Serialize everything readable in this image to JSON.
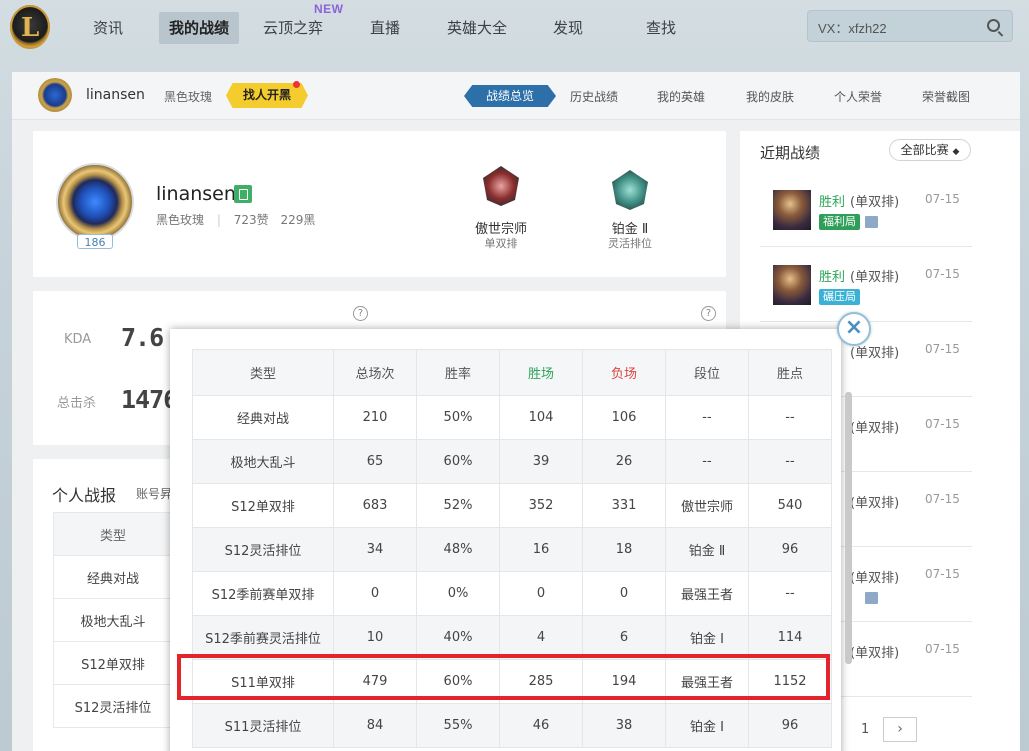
{
  "topnav": {
    "logo_text": "L",
    "items": [
      "资讯",
      "我的战绩",
      "云顶之弈",
      "直播",
      "英雄大全",
      "发现",
      "查找"
    ],
    "active": "我的战绩",
    "new_badge": "NEW",
    "search_value": "VX：xfzh22"
  },
  "subnav": {
    "username": "linansen",
    "server": "黑色玫瑰",
    "find_btn": "找人开黑",
    "tabs": [
      "战绩总览",
      "历史战绩",
      "我的英雄",
      "我的皮肤",
      "个人荣誉",
      "荣誉截图"
    ]
  },
  "profile": {
    "name": "linansen",
    "server": "黑色玫瑰",
    "likes": "723赞",
    "dislikes": "229黑",
    "level": "186",
    "ranks": [
      {
        "title": "傲世宗师",
        "sub": "单双排"
      },
      {
        "title": "铂金 Ⅱ",
        "sub": "灵活排位"
      }
    ]
  },
  "stats": {
    "kda_label": "KDA",
    "kda_value": "7.6",
    "kills_label": "总击杀",
    "kills_value": "1476",
    "help": "?"
  },
  "report": {
    "title": "个人战报",
    "subtitle": "账号昇",
    "header": "类型",
    "rows": [
      "经典对战",
      "极地大乱斗",
      "S12单双排",
      "S12灵活排位"
    ]
  },
  "recent": {
    "title": "近期战绩",
    "filter": "全部比赛",
    "items": [
      {
        "result": "胜利",
        "mode": "(单双排)",
        "date": "07-15",
        "tag": "福利局",
        "tag_color": "#2f9e58"
      },
      {
        "result": "胜利",
        "mode": "(单双排)",
        "date": "07-15",
        "tag": "碾压局",
        "tag_color": "#3bb1d6"
      },
      {
        "result": "",
        "mode": "(单双排)",
        "date": "07-15"
      },
      {
        "result": "",
        "mode": "(单双排)",
        "date": "07-15"
      },
      {
        "result": "",
        "mode": "(单双排)",
        "date": "07-15"
      },
      {
        "result": "",
        "mode": "(单双排)",
        "date": "07-15"
      },
      {
        "result": "",
        "mode": "(单双排)",
        "date": "07-15"
      }
    ],
    "page": "1",
    "next": "›"
  },
  "popup": {
    "close": "×",
    "headers": [
      "类型",
      "总场次",
      "胜率",
      "胜场",
      "负场",
      "段位",
      "胜点"
    ],
    "rows": [
      [
        "经典对战",
        "210",
        "50%",
        "104",
        "106",
        "--",
        "--"
      ],
      [
        "极地大乱斗",
        "65",
        "60%",
        "39",
        "26",
        "--",
        "--"
      ],
      [
        "S12单双排",
        "683",
        "52%",
        "352",
        "331",
        "傲世宗师",
        "540"
      ],
      [
        "S12灵活排位",
        "34",
        "48%",
        "16",
        "18",
        "铂金 Ⅱ",
        "96"
      ],
      [
        "S12季前赛单双排",
        "0",
        "0%",
        "0",
        "0",
        "最强王者",
        "--"
      ],
      [
        "S12季前赛灵活排位",
        "10",
        "40%",
        "4",
        "6",
        "铂金 Ⅰ",
        "114"
      ],
      [
        "S11单双排",
        "479",
        "60%",
        "285",
        "194",
        "最强王者",
        "1152"
      ],
      [
        "S11灵活排位",
        "84",
        "55%",
        "46",
        "38",
        "铂金 Ⅰ",
        "96"
      ]
    ],
    "highlighted_row": "S11单双排",
    "highlight_color": "#e3242b"
  }
}
